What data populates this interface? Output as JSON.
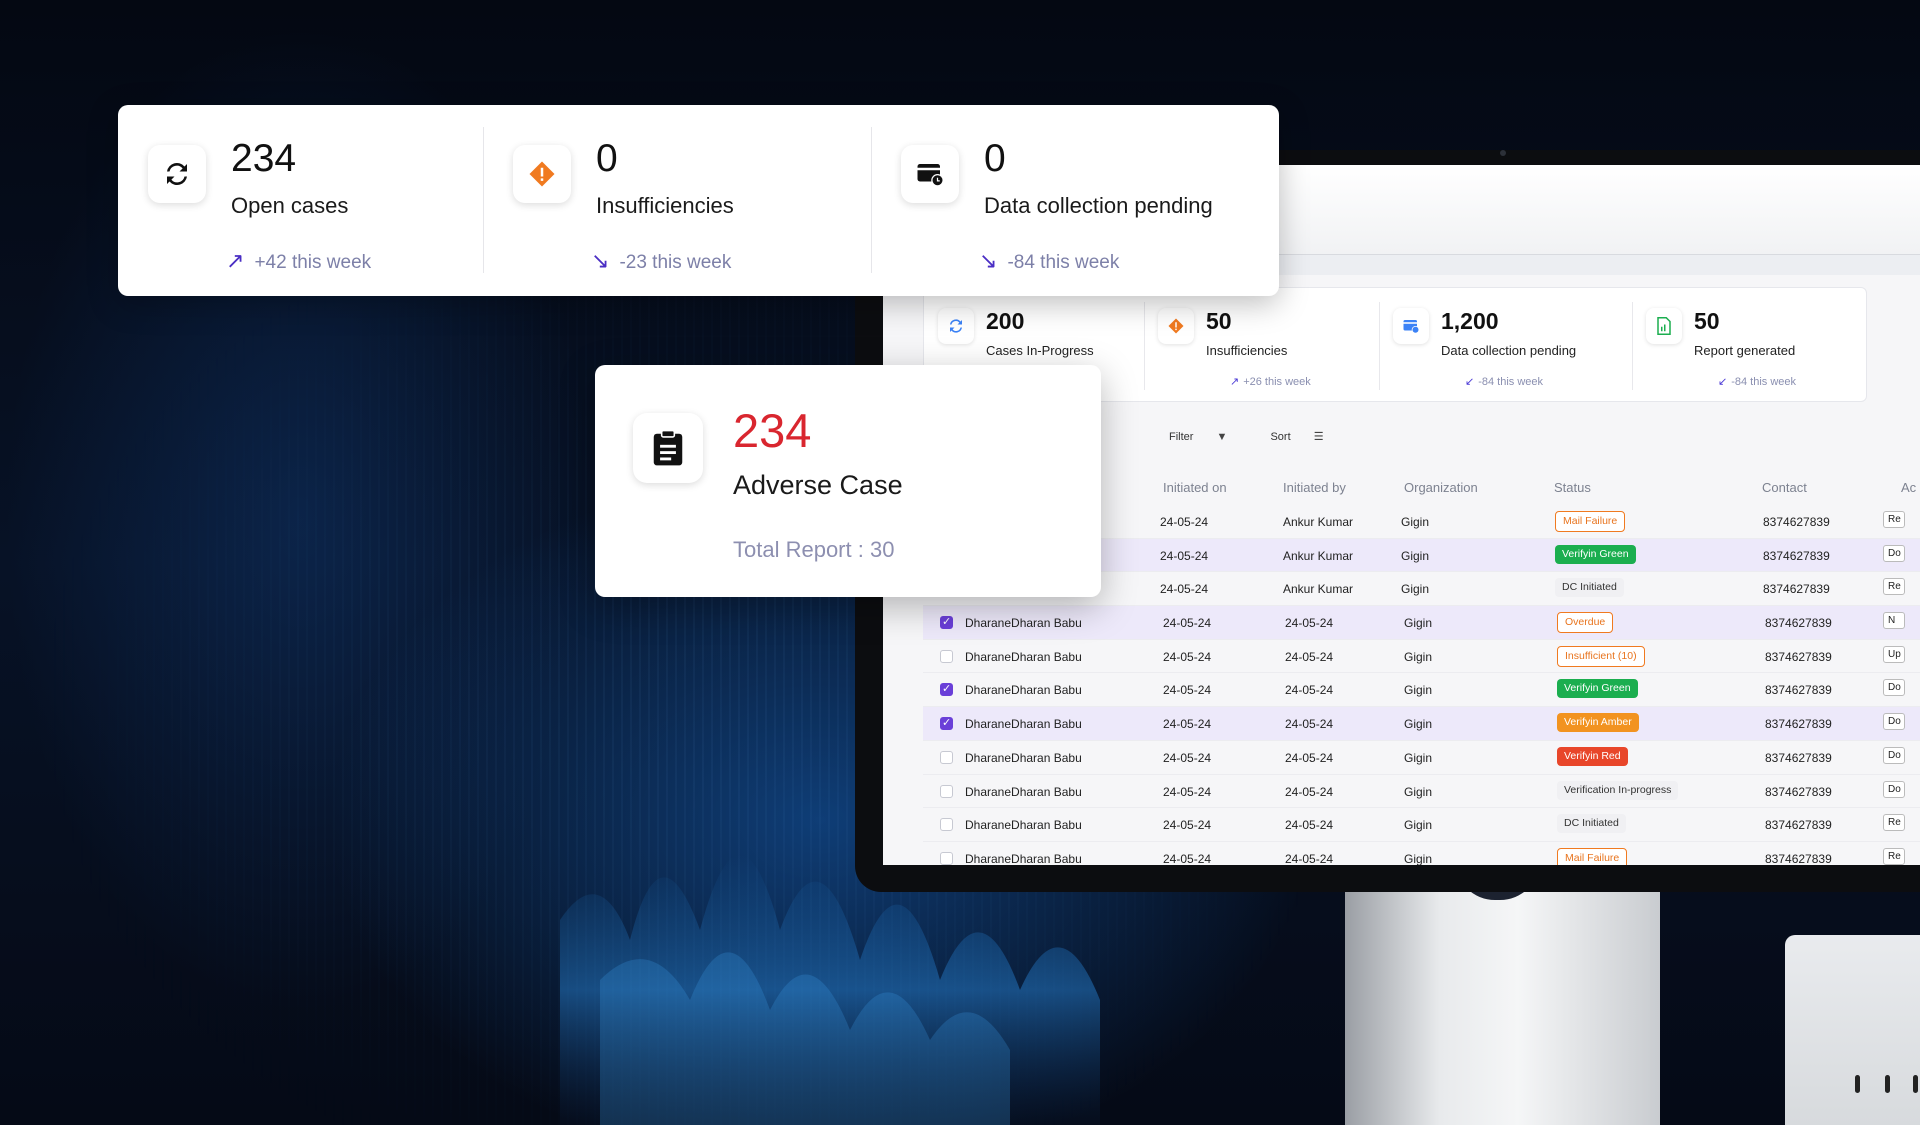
{
  "top_card": {
    "stats": [
      {
        "value": "234",
        "label": "Open cases",
        "trend": "+42 this week",
        "trend_arrow": "↗",
        "icon": "refresh-icon"
      },
      {
        "value": "0",
        "label": "Insufficiencies",
        "trend": "-23 this week",
        "trend_arrow": "↘",
        "icon": "warning-diamond-icon"
      },
      {
        "value": "0",
        "label": "Data collection pending",
        "trend": "-84 this week",
        "trend_arrow": "↘",
        "icon": "card-clock-icon"
      }
    ]
  },
  "adverse_card": {
    "value": "234",
    "label": "Adverse Case",
    "total_report": "Total Report : 30",
    "icon": "clipboard-icon"
  },
  "screen": {
    "stats": [
      {
        "value": "200",
        "label": "Cases In-Progress",
        "trend": "",
        "icon": "refresh-icon"
      },
      {
        "value": "50",
        "label": "Insufficiencies",
        "trend": "+26 this week",
        "trend_arrow": "↗",
        "icon": "warning-diamond-icon"
      },
      {
        "value": "1,200",
        "label": "Data collection pending",
        "trend": "-84 this week",
        "trend_arrow": "↙",
        "icon": "card-clock-icon"
      },
      {
        "value": "50",
        "label": "Report generated",
        "trend": "-84 this week",
        "trend_arrow": "↙",
        "icon": "report-icon"
      }
    ],
    "toolbar": {
      "filter": "Filter",
      "sort": "Sort"
    },
    "columns": [
      "Initiated on",
      "Initiated by",
      "Organization",
      "Status",
      "Contact",
      "Ac"
    ],
    "rows": [
      {
        "checkbox": "none",
        "name": "",
        "initiated_on": "24-05-24",
        "initiated_by": "Ankur Kumar",
        "org": "Gigin",
        "status": "Mail Failure",
        "status_style": "outline-orange",
        "contact": "8374627839",
        "selected": false,
        "action": "Re"
      },
      {
        "checkbox": "none",
        "name": "",
        "initiated_on": "24-05-24",
        "initiated_by": "Ankur Kumar",
        "org": "Gigin",
        "status": "Verifyin Green",
        "status_style": "green",
        "contact": "8374627839",
        "selected": true,
        "action": "Do"
      },
      {
        "checkbox": "none",
        "name": "",
        "initiated_on": "24-05-24",
        "initiated_by": "Ankur Kumar",
        "org": "Gigin",
        "status": "DC Initiated",
        "status_style": "grey",
        "contact": "8374627839",
        "selected": false,
        "action": "Re"
      },
      {
        "checkbox": "on",
        "name": "DharaneDharan Babu",
        "initiated_on": "24-05-24",
        "initiated_by": "24-05-24",
        "org": "Gigin",
        "status": "Overdue",
        "status_style": "outline-orange",
        "contact": "8374627839",
        "selected": true,
        "action": "N"
      },
      {
        "checkbox": "off",
        "name": "DharaneDharan Babu",
        "initiated_on": "24-05-24",
        "initiated_by": "24-05-24",
        "org": "Gigin",
        "status": "Insufficient (10)",
        "status_style": "outline-orange",
        "contact": "8374627839",
        "selected": false,
        "action": "Up"
      },
      {
        "checkbox": "on",
        "name": "DharaneDharan Babu",
        "initiated_on": "24-05-24",
        "initiated_by": "24-05-24",
        "org": "Gigin",
        "status": "Verifyin Green",
        "status_style": "green",
        "contact": "8374627839",
        "selected": false,
        "action": "Do"
      },
      {
        "checkbox": "on",
        "name": "DharaneDharan Babu",
        "initiated_on": "24-05-24",
        "initiated_by": "24-05-24",
        "org": "Gigin",
        "status": "Verifyin Amber",
        "status_style": "amber",
        "contact": "8374627839",
        "selected": true,
        "action": "Do"
      },
      {
        "checkbox": "off",
        "name": "DharaneDharan Babu",
        "initiated_on": "24-05-24",
        "initiated_by": "24-05-24",
        "org": "Gigin",
        "status": "Verifyin Red",
        "status_style": "red",
        "contact": "8374627839",
        "selected": false,
        "action": "Do"
      },
      {
        "checkbox": "off",
        "name": "DharaneDharan Babu",
        "initiated_on": "24-05-24",
        "initiated_by": "24-05-24",
        "org": "Gigin",
        "status": "Verification In-progress",
        "status_style": "grey",
        "contact": "8374627839",
        "selected": false,
        "action": "Do"
      },
      {
        "checkbox": "off",
        "name": "DharaneDharan Babu",
        "initiated_on": "24-05-24",
        "initiated_by": "24-05-24",
        "org": "Gigin",
        "status": "DC Initiated",
        "status_style": "grey",
        "contact": "8374627839",
        "selected": false,
        "action": "Re"
      },
      {
        "checkbox": "off",
        "name": "DharaneDharan Babu",
        "initiated_on": "24-05-24",
        "initiated_by": "24-05-24",
        "org": "Gigin",
        "status": "Mail Failure",
        "status_style": "outline-orange",
        "contact": "8374627839",
        "selected": false,
        "action": "Re"
      }
    ]
  },
  "colors": {
    "accent_purple": "#4a2ec4",
    "adverse_red": "#d9262f",
    "warning_orange": "#f07a20",
    "green": "#1bae4f"
  }
}
